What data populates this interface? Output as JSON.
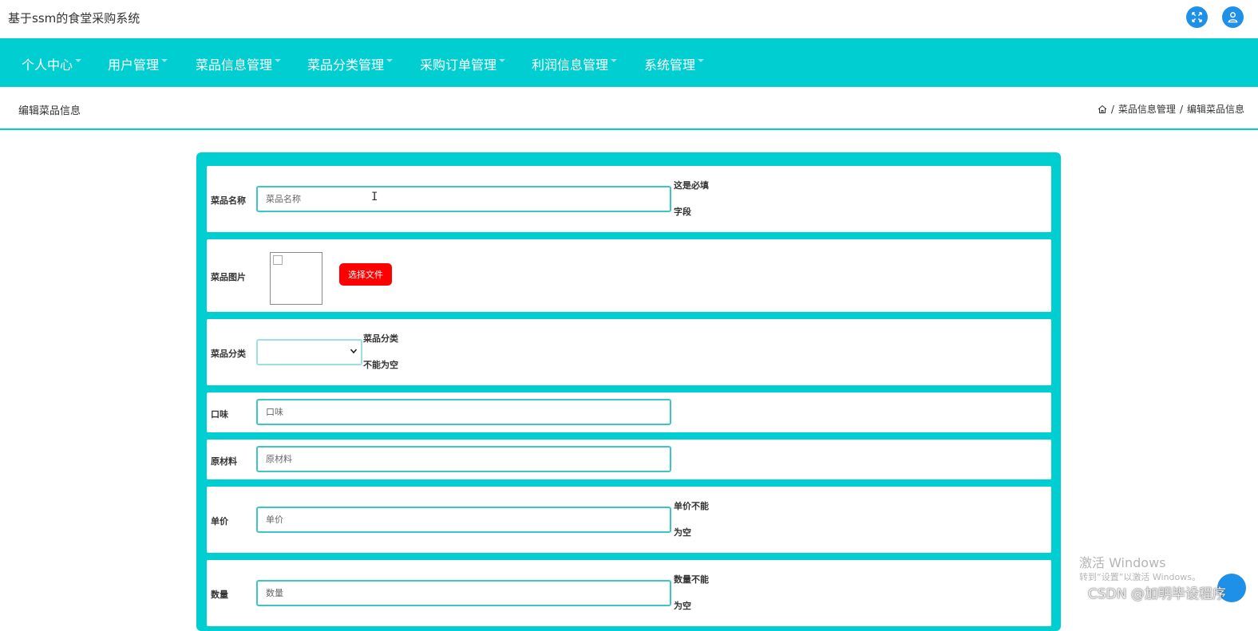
{
  "app_title": "基于ssm的食堂采购系统",
  "header_icons": [
    "fullscreen-icon",
    "user-icon"
  ],
  "nav": [
    {
      "label": "个人中心"
    },
    {
      "label": "用户管理"
    },
    {
      "label": "菜品信息管理"
    },
    {
      "label": "菜品分类管理"
    },
    {
      "label": "采购订单管理"
    },
    {
      "label": "利润信息管理"
    },
    {
      "label": "系统管理"
    }
  ],
  "page_title": "编辑菜品信息",
  "breadcrumb": {
    "sep": "/",
    "level1": "菜品信息管理",
    "level2": "编辑菜品信息"
  },
  "form": {
    "name": {
      "label": "菜品名称",
      "placeholder": "菜品名称",
      "hint1": "这是必填",
      "hint2": "字段"
    },
    "image": {
      "label": "菜品图片",
      "button": "选择文件"
    },
    "category": {
      "label": "菜品分类",
      "value": "",
      "hint1": "菜品分类",
      "hint2": "不能为空"
    },
    "taste": {
      "label": "口味",
      "placeholder": "口味"
    },
    "material": {
      "label": "原材料",
      "placeholder": "原材料"
    },
    "price": {
      "label": "单价",
      "placeholder": "单价",
      "hint1": "单价不能",
      "hint2": "为空"
    },
    "quantity": {
      "label": "数量",
      "placeholder": "数量",
      "hint1": "数量不能",
      "hint2": "为空"
    }
  },
  "watermark": {
    "activate_title": "激活 Windows",
    "activate_sub": "转到“设置”以激活 Windows。",
    "csdn": "CSDN @加明毕设程序"
  },
  "colors": {
    "primary": "#00ced1",
    "accent_blue": "#1e90e8",
    "file_button": "#ff0000"
  }
}
